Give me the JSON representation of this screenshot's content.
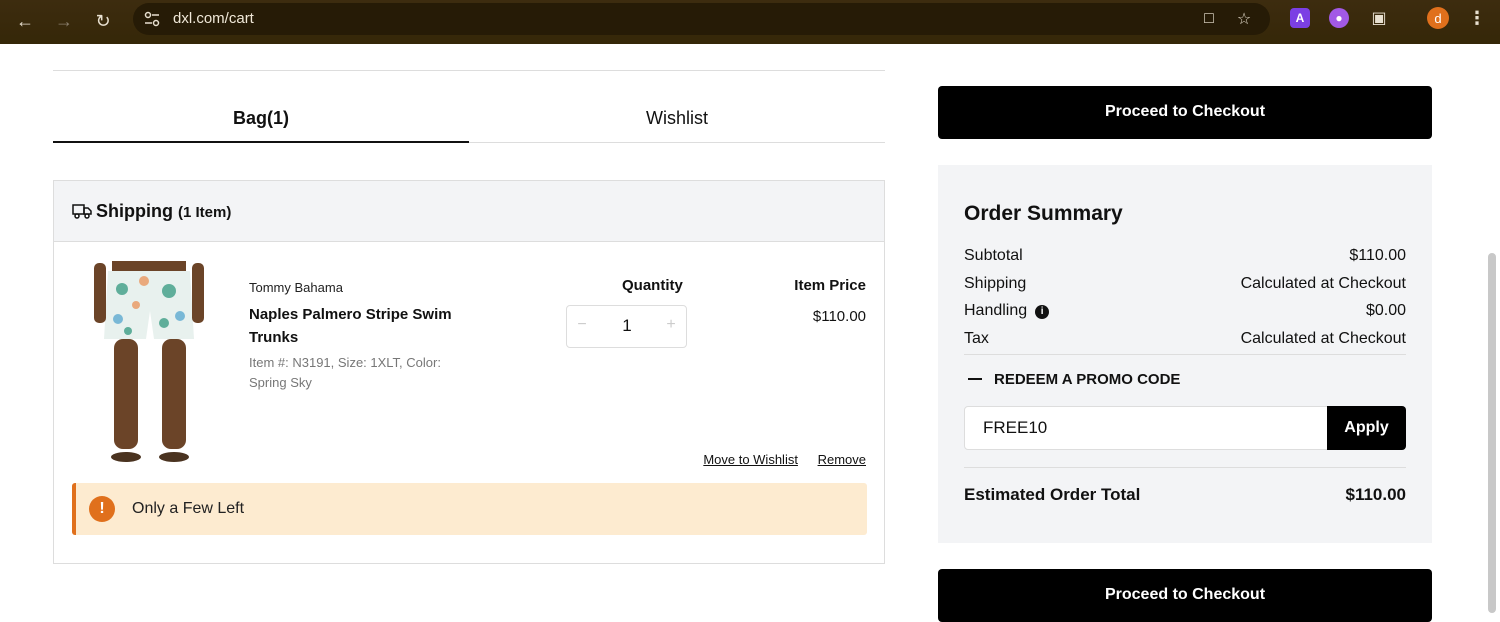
{
  "browser": {
    "url": "dxl.com/cart",
    "avatar_letter": "d",
    "extension_a": "A"
  },
  "tabs": {
    "bag": "Bag(1)",
    "wishlist": "Wishlist"
  },
  "shipping": {
    "title": "Shipping",
    "count": "(1 Item)"
  },
  "item": {
    "brand": "Tommy Bahama",
    "name": "Naples Palmero Stripe Swim Trunks",
    "meta": "Item #: N3191, Size: 1XLT, Color: Spring Sky",
    "quantity_label": "Quantity",
    "quantity": "1",
    "price_label": "Item Price",
    "price": "$110.00",
    "move_to_wishlist": "Move to Wishlist",
    "remove": "Remove",
    "alert": "Only a Few Left",
    "alert_icon": "!"
  },
  "checkout_label": "Proceed to Checkout",
  "summary": {
    "title": "Order Summary",
    "subtotal_label": "Subtotal",
    "subtotal": "$110.00",
    "shipping_label": "Shipping",
    "shipping": "Calculated at Checkout",
    "handling_label": "Handling",
    "handling": "$0.00",
    "tax_label": "Tax",
    "tax": "Calculated at Checkout",
    "promo_label": "REDEEM A PROMO CODE",
    "promo_value": "FREE10",
    "apply_label": "Apply",
    "total_label": "Estimated Order Total",
    "total": "$110.00"
  },
  "colors": {
    "accent": "#e0701c",
    "alert_bg": "#fdebd0",
    "panel_bg": "#f3f4f6",
    "button_bg": "#000000"
  }
}
